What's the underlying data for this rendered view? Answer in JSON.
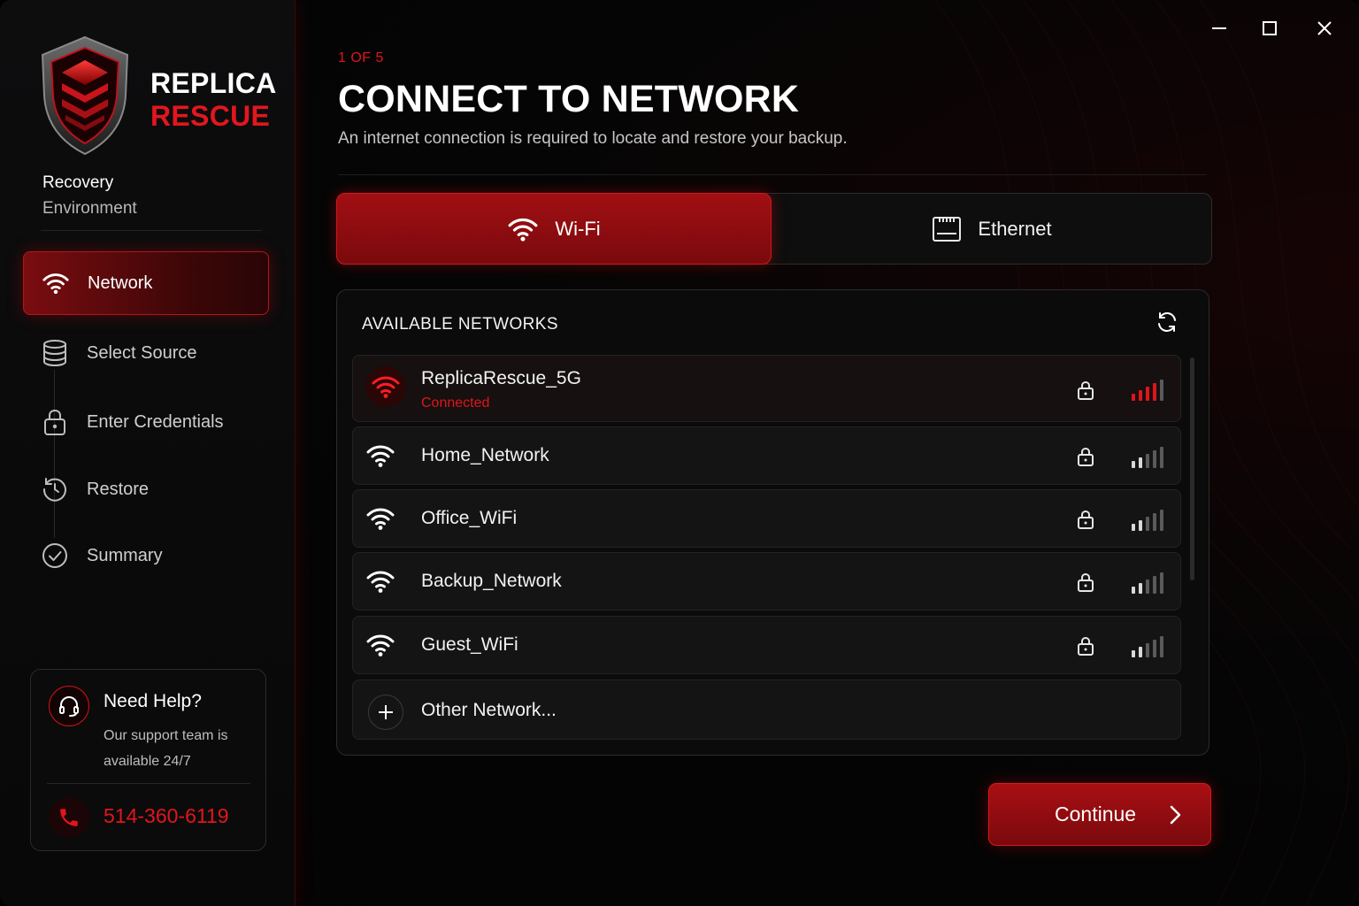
{
  "colors": {
    "accent": "#e0151c",
    "background": "#050505",
    "panel": "#0b0b0b",
    "row": "#141414"
  },
  "brand": {
    "line1": "REPLICA",
    "line2": "RESCUE",
    "env_line1": "Recovery",
    "env_line2": "Environment"
  },
  "sidebar": {
    "items": [
      {
        "label": "Network",
        "icon": "wifi-icon",
        "active": true
      },
      {
        "label": "Select Source",
        "icon": "database-icon",
        "active": false
      },
      {
        "label": "Enter Credentials",
        "icon": "lock-icon",
        "active": false
      },
      {
        "label": "Restore",
        "icon": "restore-icon",
        "active": false
      },
      {
        "label": "Summary",
        "icon": "check-circle-icon",
        "active": false
      }
    ]
  },
  "help": {
    "title": "Need Help?",
    "text": "Our support team is available 24/7",
    "phone": "514-360-6119"
  },
  "header": {
    "step": "1 OF 5",
    "title": "CONNECT TO NETWORK",
    "subtitle": "An internet connection is required to locate and restore your backup."
  },
  "tabs": [
    {
      "label": "Wi-Fi",
      "icon": "wifi-icon",
      "active": true
    },
    {
      "label": "Ethernet",
      "icon": "ethernet-icon",
      "active": false
    }
  ],
  "networks": {
    "title": "AVAILABLE NETWORKS",
    "list": [
      {
        "name": "ReplicaRescue_5G",
        "status": "Connected",
        "secured": true,
        "signal_bars": 4,
        "connected": true
      },
      {
        "name": "Home_Network",
        "status": "",
        "secured": true,
        "signal_bars": 2,
        "connected": false
      },
      {
        "name": "Office_WiFi",
        "status": "",
        "secured": true,
        "signal_bars": 2,
        "connected": false
      },
      {
        "name": "Backup_Network",
        "status": "",
        "secured": true,
        "signal_bars": 2,
        "connected": false
      },
      {
        "name": "Guest_WiFi",
        "status": "",
        "secured": true,
        "signal_bars": 2,
        "connected": false
      }
    ],
    "other_label": "Other Network..."
  },
  "footer": {
    "continue_label": "Continue"
  }
}
